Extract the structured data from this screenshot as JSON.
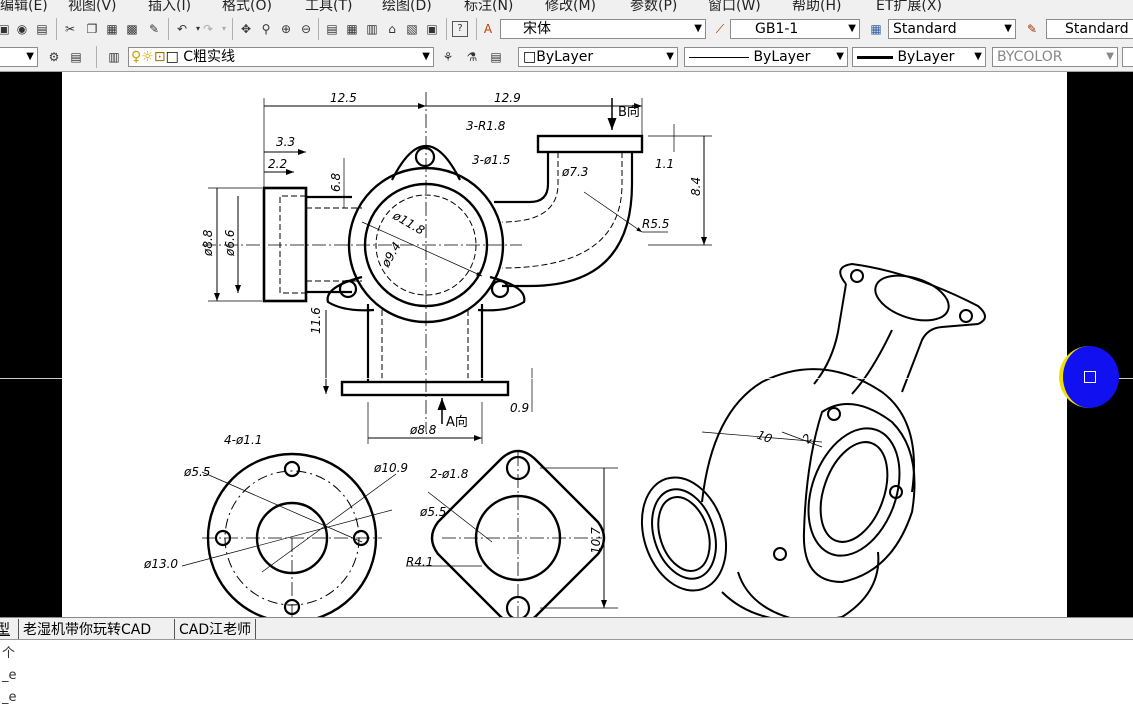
{
  "menu": [
    "编辑(E)",
    "视图(V)",
    "插入(I)",
    "格式(O)",
    "工具(T)",
    "绘图(D)",
    "标注(N)",
    "修改(M)",
    "参数(P)",
    "窗口(W)",
    "帮助(H)",
    "ET扩展(X)"
  ],
  "toolbar1": {
    "font": "宋体",
    "dimstyle": "GB1-1",
    "textstyle": "Standard",
    "tablestyle": "Standard"
  },
  "toolbar2": {
    "layer": "C粗实线",
    "color": "ByLayer",
    "linetype": "ByLayer",
    "lineweight": "ByLayer",
    "plotstyle": "BYCOLOR"
  },
  "drawing": {
    "dims": {
      "d12_5": "12.5",
      "d12_9": "12.9",
      "d3_3": "3.3",
      "d2_2": "2.2",
      "d6_8": "6.8",
      "r3": "3-R1.8",
      "h3": "3-ø1.5",
      "p73": "ø7.3",
      "d11": "1.1",
      "d84": "8.4",
      "r55": "R5.5",
      "p88": "ø8.8",
      "p66": "ø6.6",
      "p118": "ø11.8",
      "p94": "ø9.4",
      "d116": "11.6",
      "d09": "0.9",
      "p88b": "ø8.8",
      "view_a": "A向",
      "view_b": "B向",
      "h4": "4-ø1.1",
      "p55": "ø5.5",
      "p109": "ø10.9",
      "p130": "ø13.0",
      "h2": "2-ø1.8",
      "p55b": "ø5.5",
      "r41": "R4.1",
      "d107": "10.7",
      "d10": "10",
      "d2": "2"
    }
  },
  "tabs": [
    "型",
    "老湿机带你玩转CAD",
    "CAD江老师"
  ],
  "command_lines": [
    "个",
    "_e",
    "_e"
  ]
}
